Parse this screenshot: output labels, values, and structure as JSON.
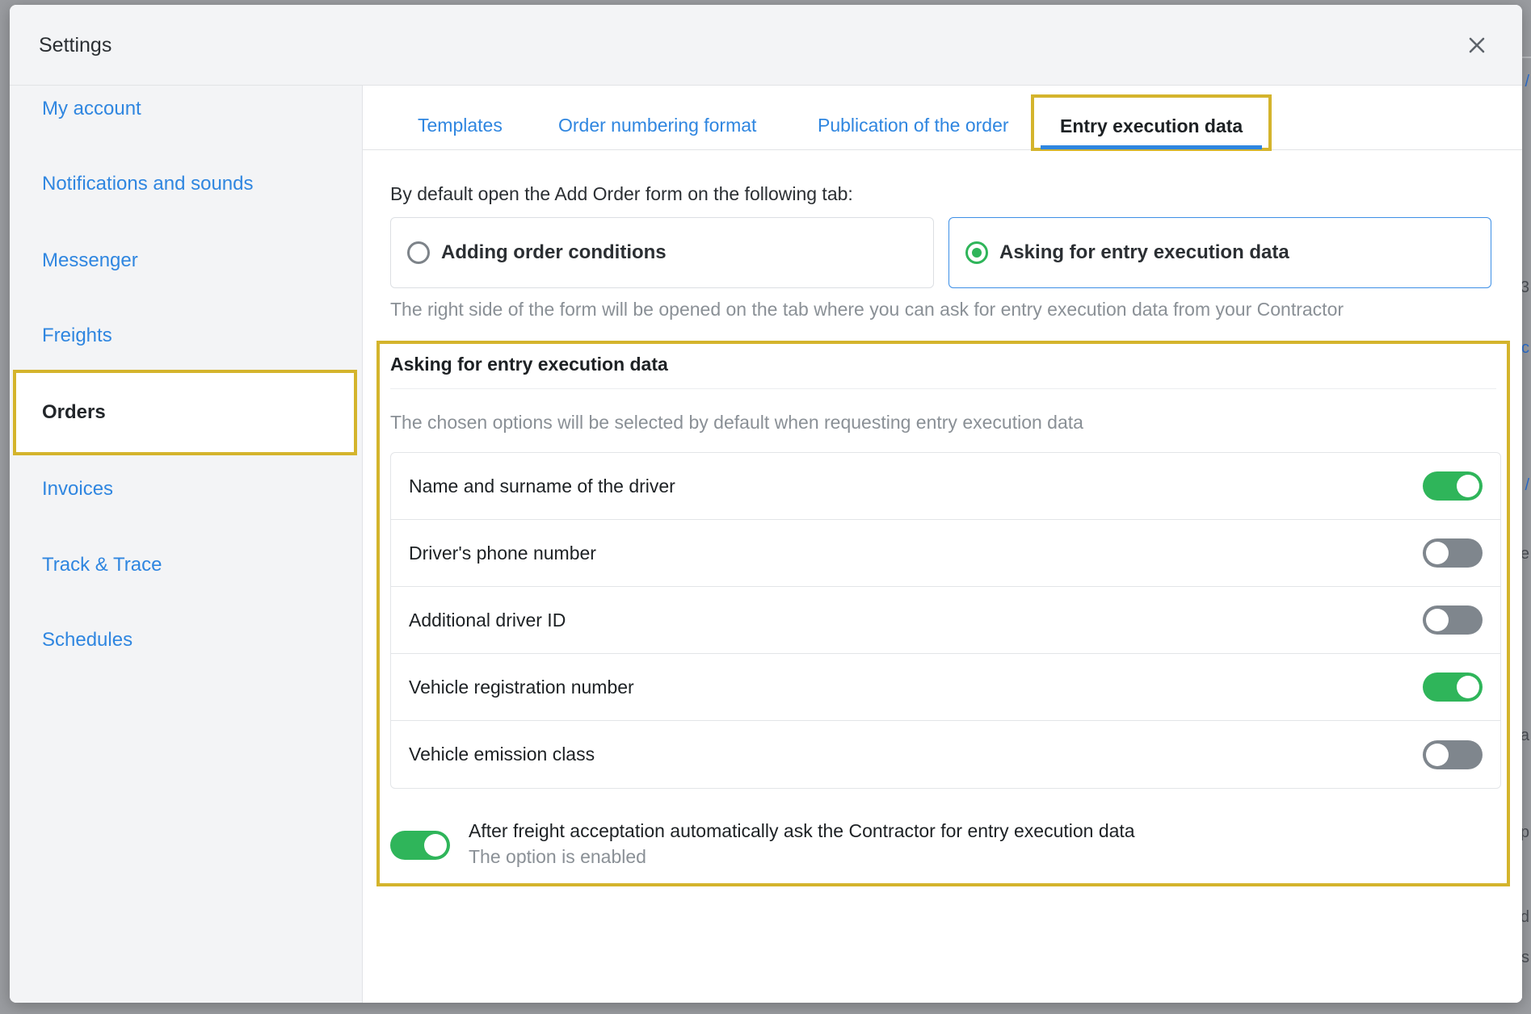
{
  "colors": {
    "accent": "#2f86e0",
    "success": "#2fb55a",
    "highlight": "#d4b42c",
    "toggle_off": "#7f868d"
  },
  "modal": {
    "title": "Settings",
    "close_icon": "close-icon"
  },
  "sidebar": {
    "items": [
      {
        "label": "My account",
        "active": false
      },
      {
        "label": "Notifications and sounds",
        "active": false
      },
      {
        "label": "Messenger",
        "active": false
      },
      {
        "label": "Freights",
        "active": false
      },
      {
        "label": "Orders",
        "active": true
      },
      {
        "label": "Invoices",
        "active": false
      },
      {
        "label": "Track & Trace",
        "active": false
      },
      {
        "label": "Schedules",
        "active": false
      }
    ]
  },
  "tabs": [
    {
      "label": "Templates",
      "active": false
    },
    {
      "label": "Order numbering format",
      "active": false
    },
    {
      "label": "Publication of the order",
      "active": false
    },
    {
      "label": "Entry execution data",
      "active": true
    }
  ],
  "default_tab": {
    "intro": "By default open the Add Order form on the following tab:",
    "options": [
      {
        "label": "Adding order conditions",
        "selected": false
      },
      {
        "label": "Asking for entry execution data",
        "selected": true
      }
    ],
    "hint": "The right side of the form will be opened on the tab where you can ask for entry execution data from your Contractor"
  },
  "section": {
    "title": "Asking for entry execution data",
    "description": "The chosen options will be selected by default when requesting entry execution data",
    "options": [
      {
        "label": "Name and surname of the driver",
        "enabled": true
      },
      {
        "label": "Driver's phone number",
        "enabled": false
      },
      {
        "label": "Additional driver ID",
        "enabled": false
      },
      {
        "label": "Vehicle registration number",
        "enabled": true
      },
      {
        "label": "Vehicle emission class",
        "enabled": false
      }
    ],
    "auto_ask": {
      "label": "After freight acceptation automatically ask the Contractor for entry execution data",
      "status": "The option is enabled",
      "enabled": true
    }
  }
}
